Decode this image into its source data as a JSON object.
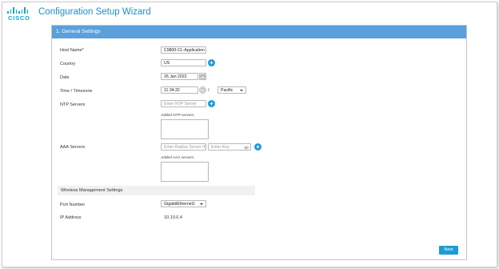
{
  "brand": {
    "wordmark": "CISCO"
  },
  "app_title": "Configuration Setup Wizard",
  "panel": {
    "title": "1. General Settings"
  },
  "fields": {
    "host_name": {
      "label": "Host Name*",
      "value": "C9800-CL-Application"
    },
    "country": {
      "label": "Country",
      "value": "US"
    },
    "date": {
      "label": "Date",
      "value": "26 Jan 2022"
    },
    "time": {
      "label": "Time / Timezone",
      "value": "11:34:32",
      "separator": "/",
      "timezone": "Pacific"
    },
    "ntp": {
      "label": "NTP Servers",
      "placeholder": "Enter NTP Server",
      "added_label": "Added NTP servers"
    },
    "aaa": {
      "label": "AAA Servers",
      "ip_placeholder": "Enter Radius Server IP",
      "key_placeholder": "Enter Key",
      "added_label": "Added AAA servers"
    }
  },
  "wireless": {
    "section_title": "Wireless Management Settings",
    "port_label": "Port Number",
    "port_value": "GigabitEthernet1",
    "ip_label": "IP Address",
    "ip_value": "10.10.0.4"
  },
  "buttons": {
    "next": "Next",
    "add": "+"
  },
  "icons": {
    "date": "calendar-icon",
    "time": "clock-icon",
    "key": "eye-icon",
    "add": "plus-icon"
  },
  "colors": {
    "accent": "#1e9ad6",
    "header": "#5b9fdc",
    "title": "#1b8fce"
  }
}
